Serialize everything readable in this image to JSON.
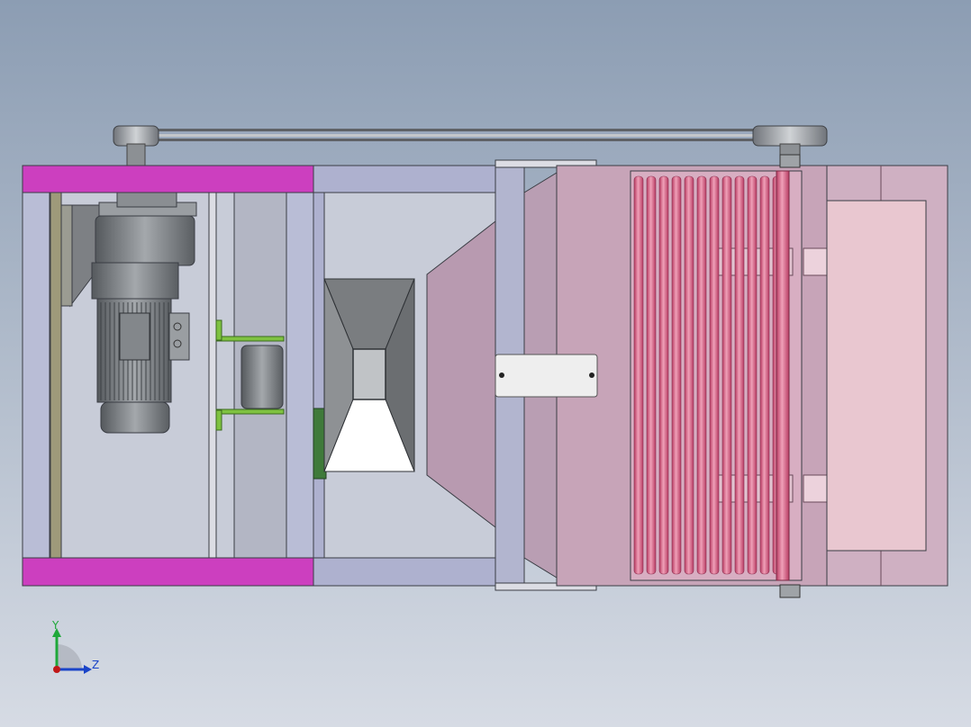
{
  "viewport": {
    "background_top": "#8c9db3",
    "background_bottom": "#d6dbe4"
  },
  "colors": {
    "frame_magenta": "#cc3fbf",
    "frame_lavender": "#aeb1cf",
    "housing_pink": "#c7a4b8",
    "housing_pink_light": "#e9c7d0",
    "roller_pink": "#dd5f86",
    "motor_gray": "#8d9195",
    "motor_dark": "#5a5e62",
    "bracket_green": "#7fc241",
    "belt_gray": "#6c6f73",
    "hopper_dark": "#6a6d70",
    "plate_white": "#eeeeee"
  },
  "scene": {
    "roller_count": 12
  },
  "triad": {
    "y_label": "Y",
    "z_label": "Z",
    "y_color": "#1fa83a",
    "z_color": "#1a44c8",
    "origin_color": "#c01818"
  }
}
